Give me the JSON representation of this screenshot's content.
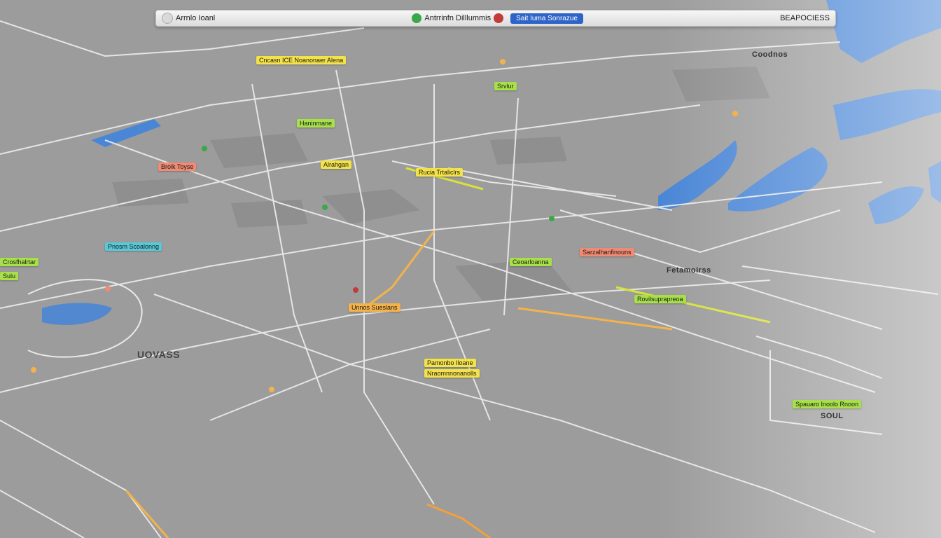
{
  "toolbar": {
    "left_text": "Arrnlo Ioanl",
    "mid_text": "Antrrinfn Dilllummis",
    "chip_label": "Sait Iuma Sonrazue",
    "right_text": "BEAPOCIESS",
    "colors": {
      "chip": "#2e63c8",
      "red_dot": "#c23a3a",
      "green": "#3aa84a"
    }
  },
  "labels": {
    "top_center": "Cncasn ICE Noanonaer Alena",
    "district_a": "Haninmane",
    "district_b": "Brolk Toyse",
    "road_label": "Alrahgan",
    "green_chip": "Srvlur",
    "waterfront": "Rucia Trtaliclrs",
    "left_street": "Crosfhalrtar",
    "left_chip": "Sulu",
    "east_area": "Sarzalhanfinouns",
    "center_label": "Pnosm Scoalonng",
    "poi_center": "Rovilsuprapreoa",
    "lake_label": "Ceoarloanna",
    "big_area": "UOVASS",
    "bottom_label_1": "Pamonbo Iloane",
    "bottom_label_2": "Nraomnnonanolls",
    "right_label_1": "Spauaro Inoolo Rnoon",
    "right_label_2": "SOUL",
    "river_label": "Unnos Sueslans",
    "north_label": "Coodnos",
    "east_label_2": "Fetamoirss"
  },
  "map_colors": {
    "land": "#9c9c9c",
    "water": "#4a86d6",
    "roads": "#e9e9e9",
    "yellow_label": "#f3e24a",
    "green_label": "#a8e04a",
    "red_label": "#f08a72",
    "cyan_label": "#58c9d8"
  }
}
